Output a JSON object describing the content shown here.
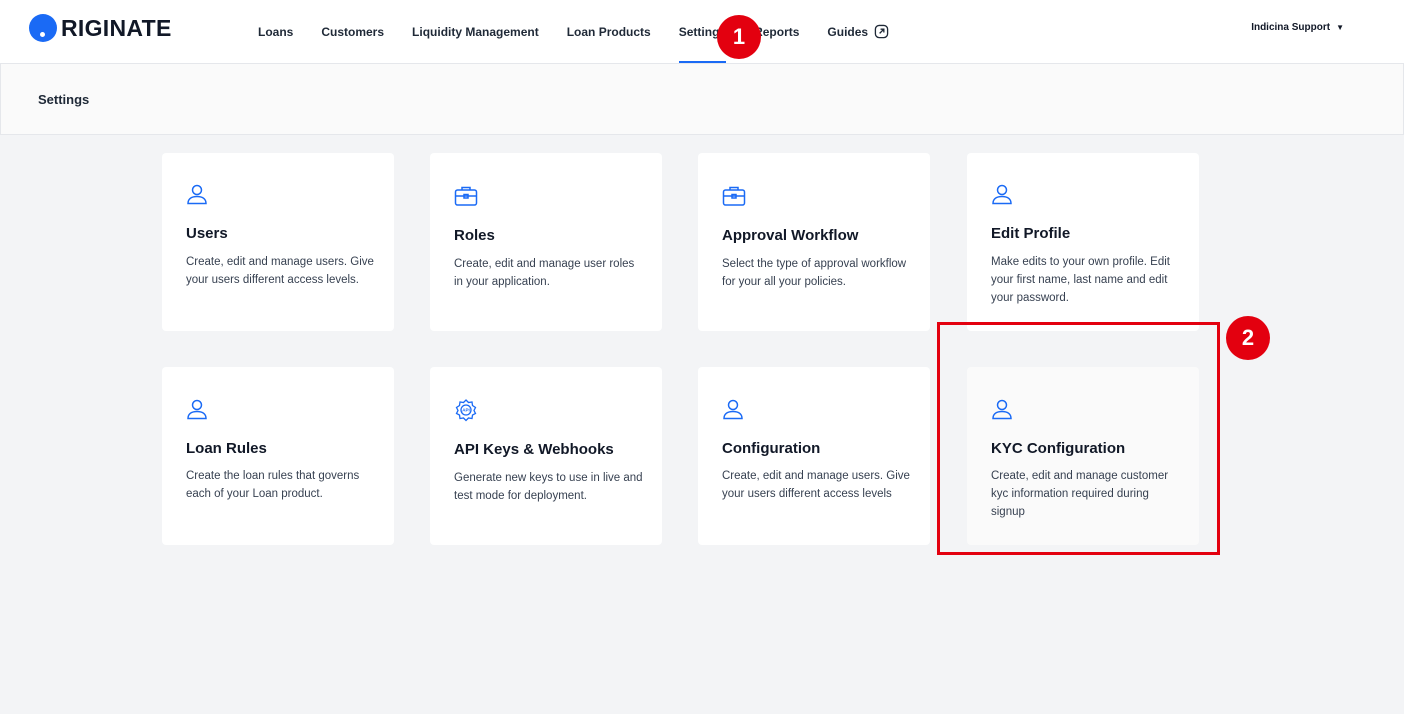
{
  "logo": {
    "text": "RIGINATE"
  },
  "nav": {
    "items": [
      {
        "label": "Loans"
      },
      {
        "label": "Customers"
      },
      {
        "label": "Liquidity Management"
      },
      {
        "label": "Loan Products"
      },
      {
        "label": "Settings",
        "active": true
      },
      {
        "label": "Reports"
      },
      {
        "label": "Guides"
      }
    ]
  },
  "user": {
    "name": "Indicina Support"
  },
  "page": {
    "title": "Settings"
  },
  "cards": [
    {
      "title": "Users",
      "description": "Create, edit and manage users. Give your users different access levels.",
      "icon": "user-icon"
    },
    {
      "title": "Roles",
      "description": "Create, edit and manage user roles in your application.",
      "icon": "briefcase-icon"
    },
    {
      "title": "Approval Workflow",
      "description": "Select the type of approval workflow for your all your policies.",
      "icon": "briefcase-icon"
    },
    {
      "title": "Edit Profile",
      "description": "Make edits to your own profile. Edit your first name, last name and edit your password.",
      "icon": "user-icon"
    },
    {
      "title": "Loan Rules",
      "description": "Create the loan rules that governs each of your Loan product.",
      "icon": "user-icon"
    },
    {
      "title": "API Keys & Webhooks",
      "description": "Generate new keys to use in live and test mode for deployment.",
      "icon": "api-icon"
    },
    {
      "title": "Configuration",
      "description": "Create, edit and manage users. Give your users different access levels",
      "icon": "user-icon"
    },
    {
      "title": "KYC Configuration",
      "description": "Create, edit and manage customer kyc information required during signup",
      "icon": "user-icon"
    }
  ],
  "annotations": {
    "badge_1": "1",
    "badge_2": "2",
    "color": "#e3000f"
  },
  "colors": {
    "accent": "#1a6af5",
    "background": "#f3f4f6"
  }
}
